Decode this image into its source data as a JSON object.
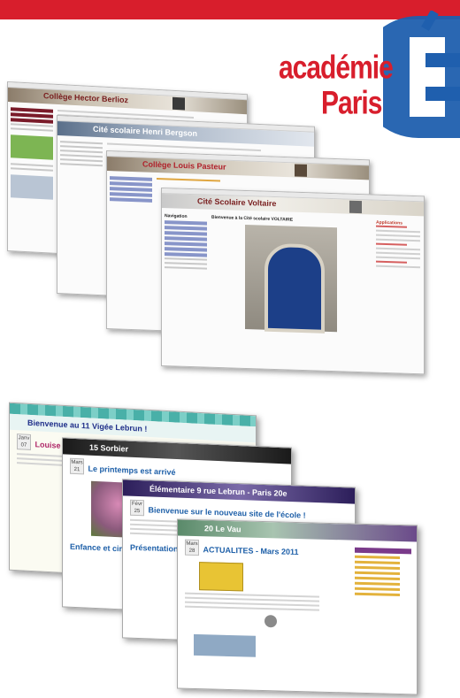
{
  "brand": {
    "name_line1": "académie",
    "name_line2": "Paris",
    "color": "#d81e2c"
  },
  "school_sites": [
    {
      "banner": "Collège Hector Berlioz"
    },
    {
      "banner": "Cité scolaire Henri Bergson"
    },
    {
      "banner": "Collège Louis Pasteur"
    },
    {
      "banner": "Cité Scolaire Voltaire",
      "welcome": "Bienvenue à la Cité scolaire VOLTAIRE",
      "section": "Navigation",
      "right_section": "Applications"
    }
  ],
  "blog_sites": [
    {
      "banner": "Bienvenue au 11 Vigée Lebrun !",
      "post_title": "Louise Elisabeth Vigée Lebrun",
      "date_month": "Janv",
      "date_day": "07",
      "header_color": "#49b0a8"
    },
    {
      "banner": "15 Sorbier",
      "post_title": "Le printemps est arrivé",
      "date_month": "Mars",
      "date_day": "21",
      "post2": "Enfance et cir...",
      "header_color": "#2a2a2a"
    },
    {
      "banner": "Élémentaire 9 rue Lebrun - Paris 20e",
      "post_title": "Bienvenue sur le nouveau site de l'école !",
      "date_month": "Févr",
      "date_day": "25",
      "post2": "Présentation",
      "header_color": "#3a2a6a"
    },
    {
      "banner": "20 Le Vau",
      "post_title": "ACTUALITES - Mars 2011",
      "date_month": "Mars",
      "date_day": "28",
      "header_color": "#3d6b6b"
    }
  ]
}
